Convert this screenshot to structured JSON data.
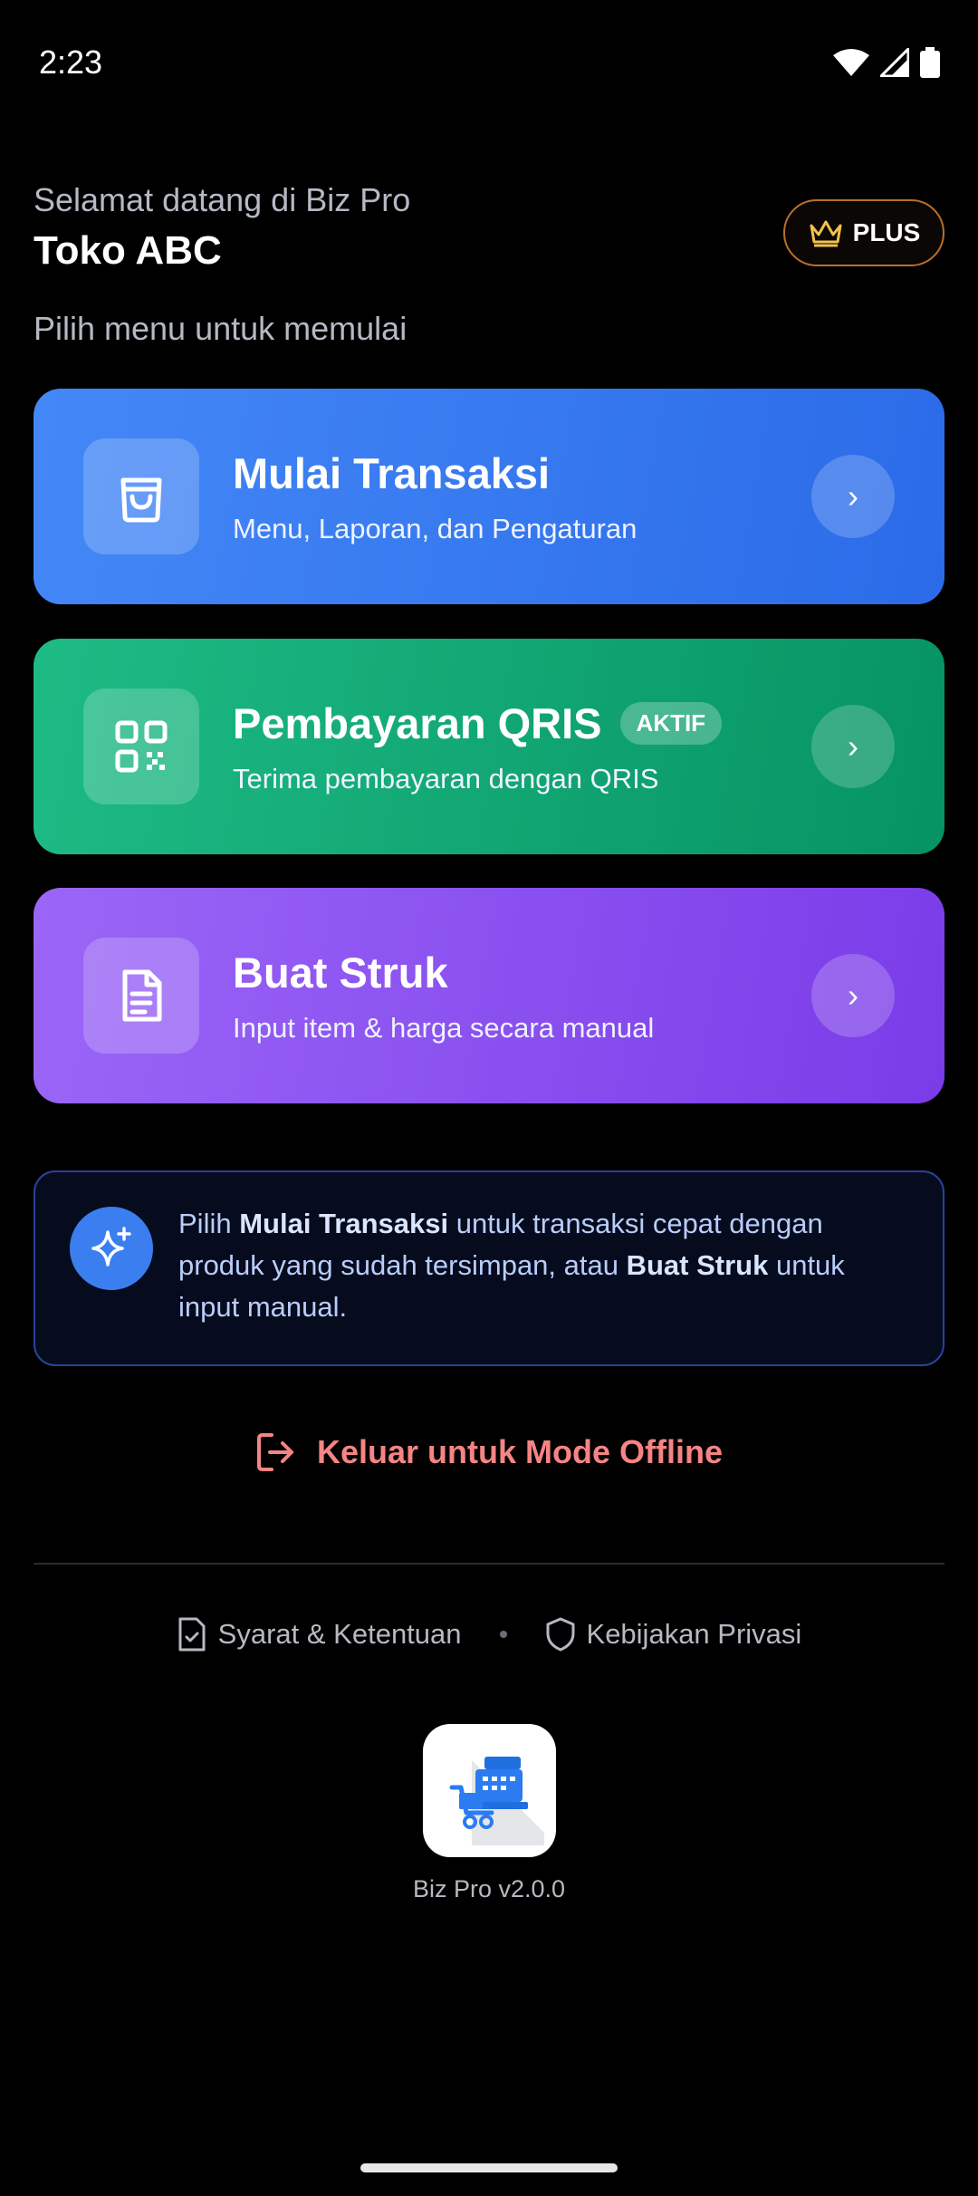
{
  "status_bar": {
    "time": "2:23"
  },
  "header": {
    "welcome": "Selamat datang di Biz Pro",
    "store_name": "Toko ABC",
    "subtitle": "Pilih menu untuk memulai",
    "plus_label": "PLUS"
  },
  "cards": [
    {
      "title": "Mulai Transaksi",
      "description": "Menu, Laporan, dan Pengaturan",
      "icon": "shopping-bag-icon",
      "color": "#3b7ef0"
    },
    {
      "title": "Pembayaran QRIS",
      "badge": "AKTIF",
      "description": "Terima pembayaran dengan QRIS",
      "icon": "qr-code-icon",
      "color": "#12a774"
    },
    {
      "title": "Buat Struk",
      "description": "Input item & harga secara manual",
      "icon": "receipt-document-icon",
      "color": "#8a4ff0"
    }
  ],
  "arrow_glyph": "›",
  "info": {
    "prefix": "Pilih ",
    "bold1": "Mulai Transaksi",
    "middle": " untuk transaksi cepat dengan produk yang sudah tersimpan, atau ",
    "bold2": "Buat Struk",
    "suffix": " untuk input manual."
  },
  "logout_label": "Keluar untuk Mode Offline",
  "footer": {
    "terms": "Syarat & Ketentuan",
    "privacy": "Kebijakan Privasi",
    "version": "Biz Pro v2.0.0"
  }
}
